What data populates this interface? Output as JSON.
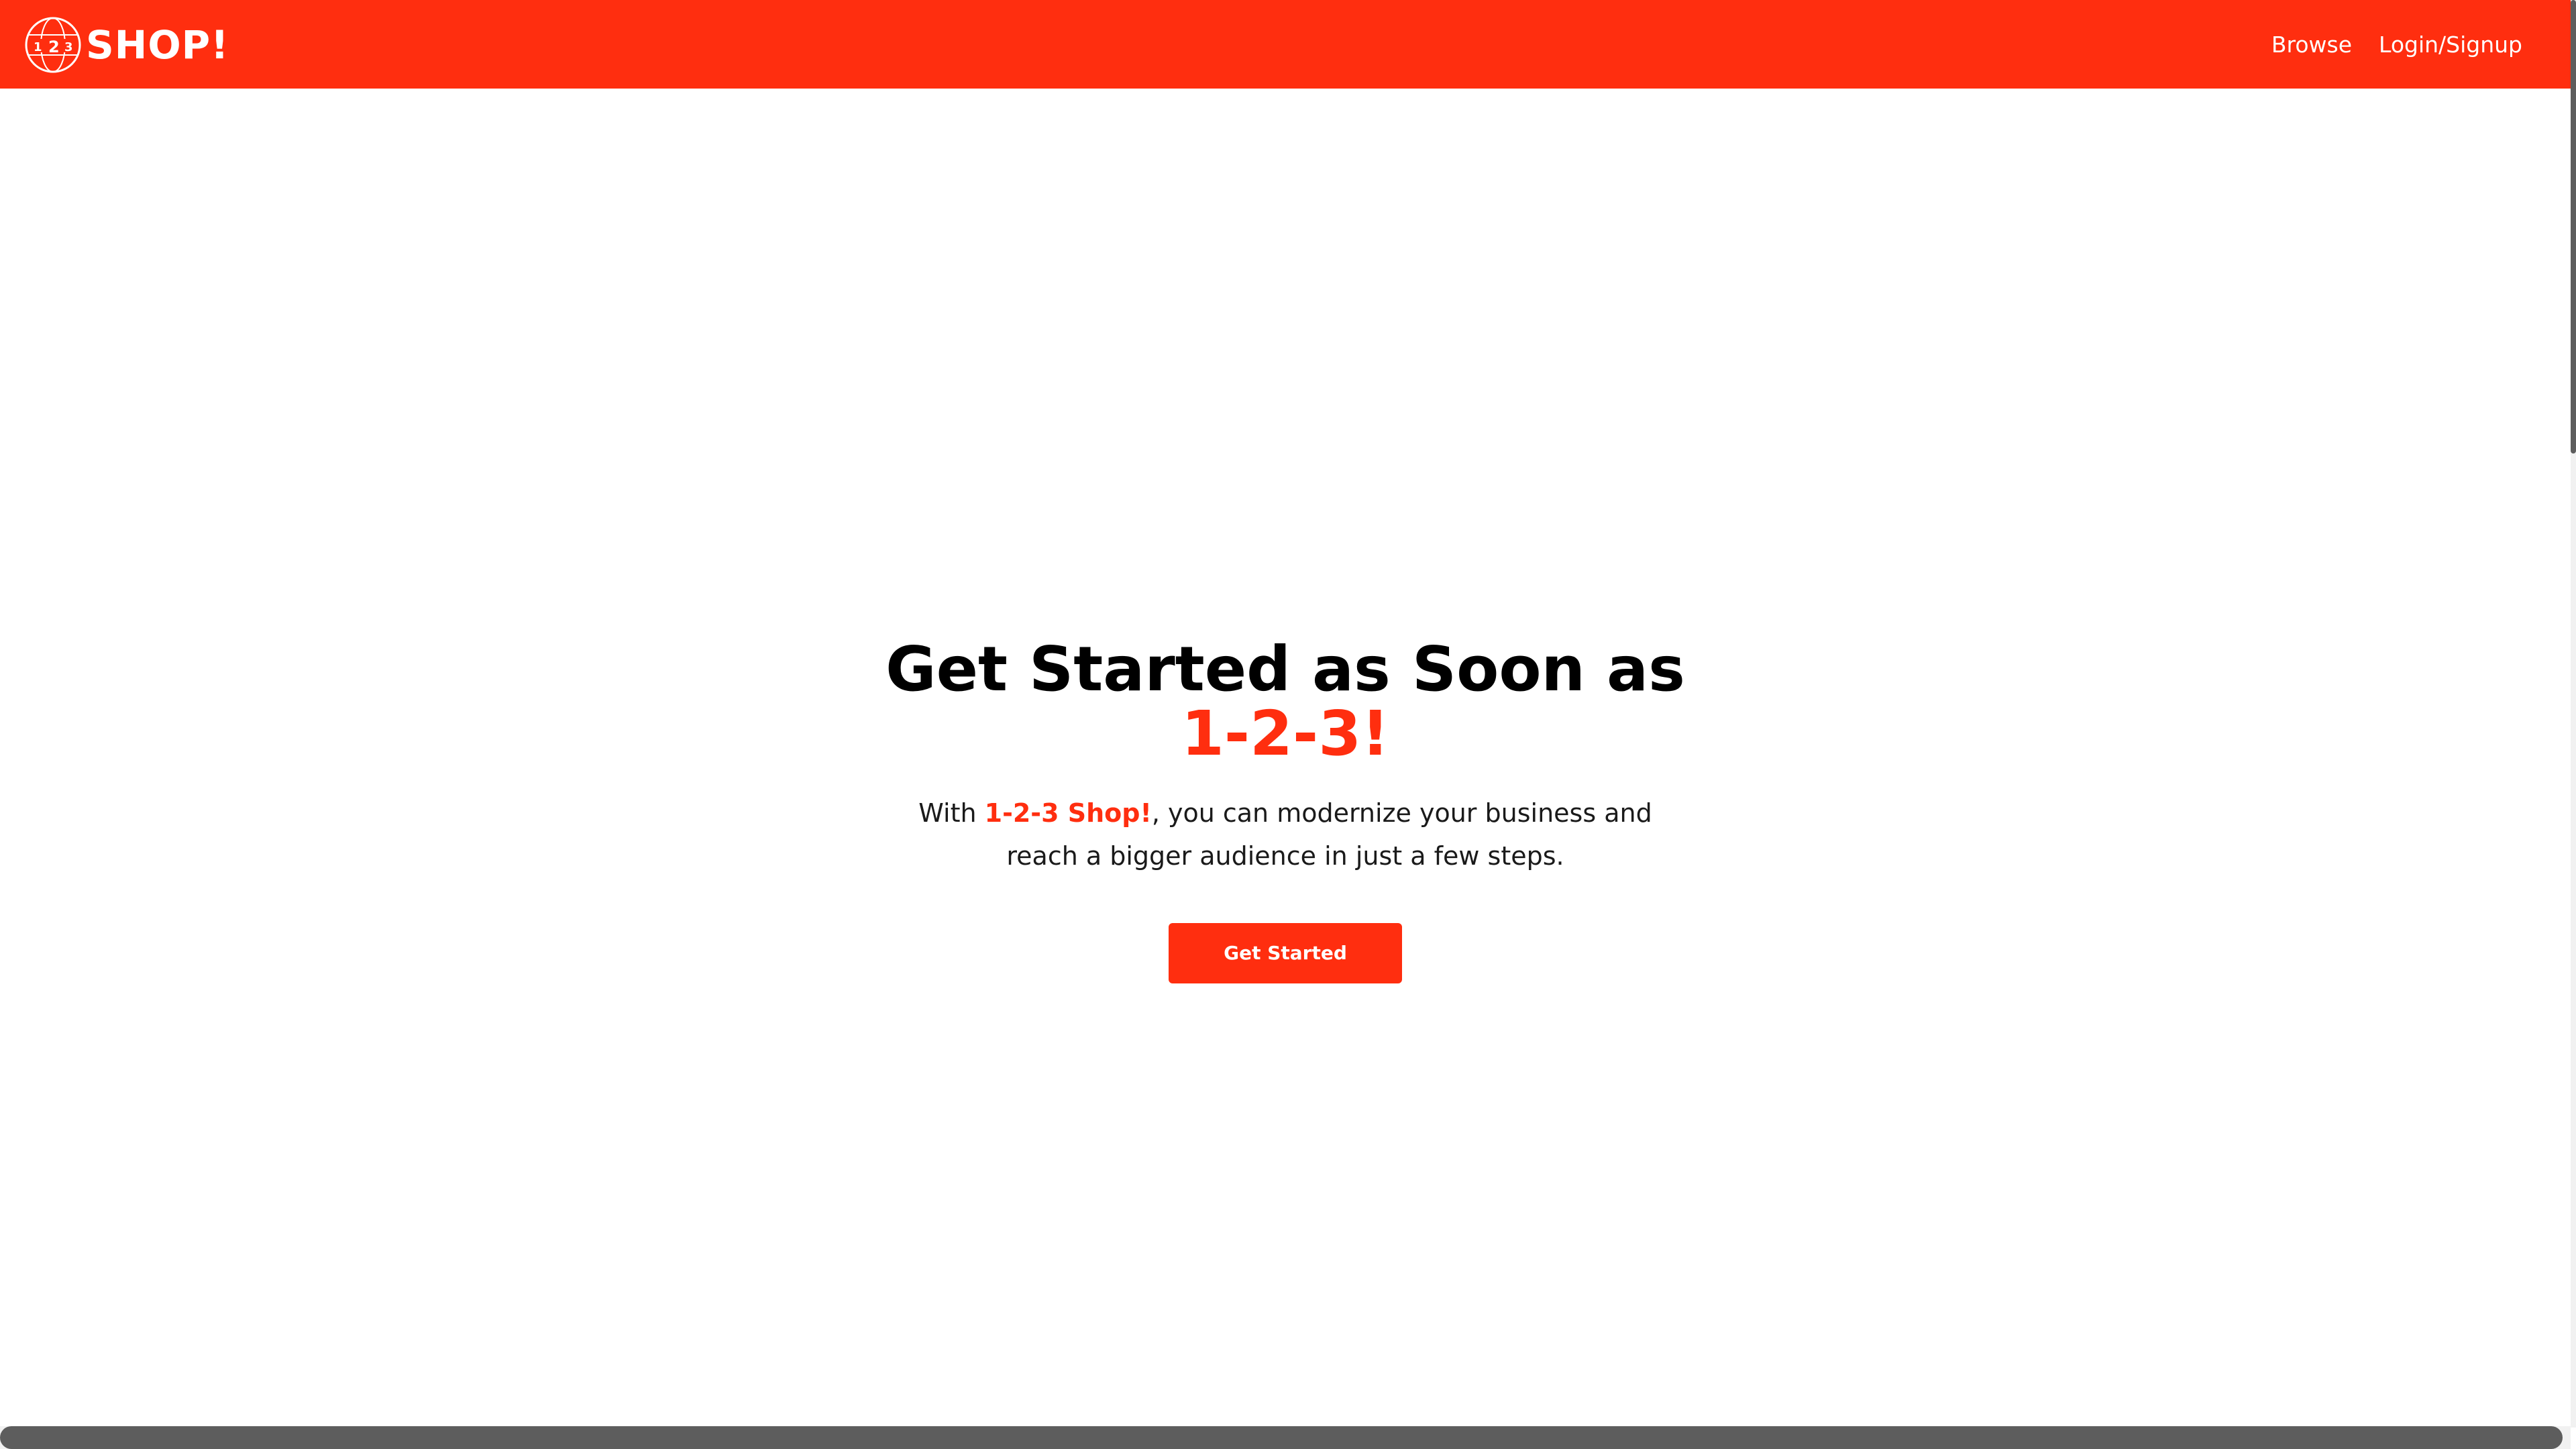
{
  "colors": {
    "brand": "#ff2e0f",
    "background": "#ffffff",
    "text": "#000000"
  },
  "header": {
    "logo": {
      "globe_digits": [
        "1",
        "2",
        "3"
      ],
      "wordmark": "SHOP!",
      "icon": "globe-icon"
    },
    "nav": [
      {
        "label": "Browse"
      },
      {
        "label": "Login/Signup"
      }
    ]
  },
  "hero": {
    "title_line1": "Get Started as Soon as",
    "title_accent": "1-2-3!",
    "text_prefix": "With ",
    "text_brand": "1-2-3 Shop!",
    "text_suffix": ", you can modernize your business and reach a bigger audience in just a few steps.",
    "cta_label": "Get Started"
  }
}
